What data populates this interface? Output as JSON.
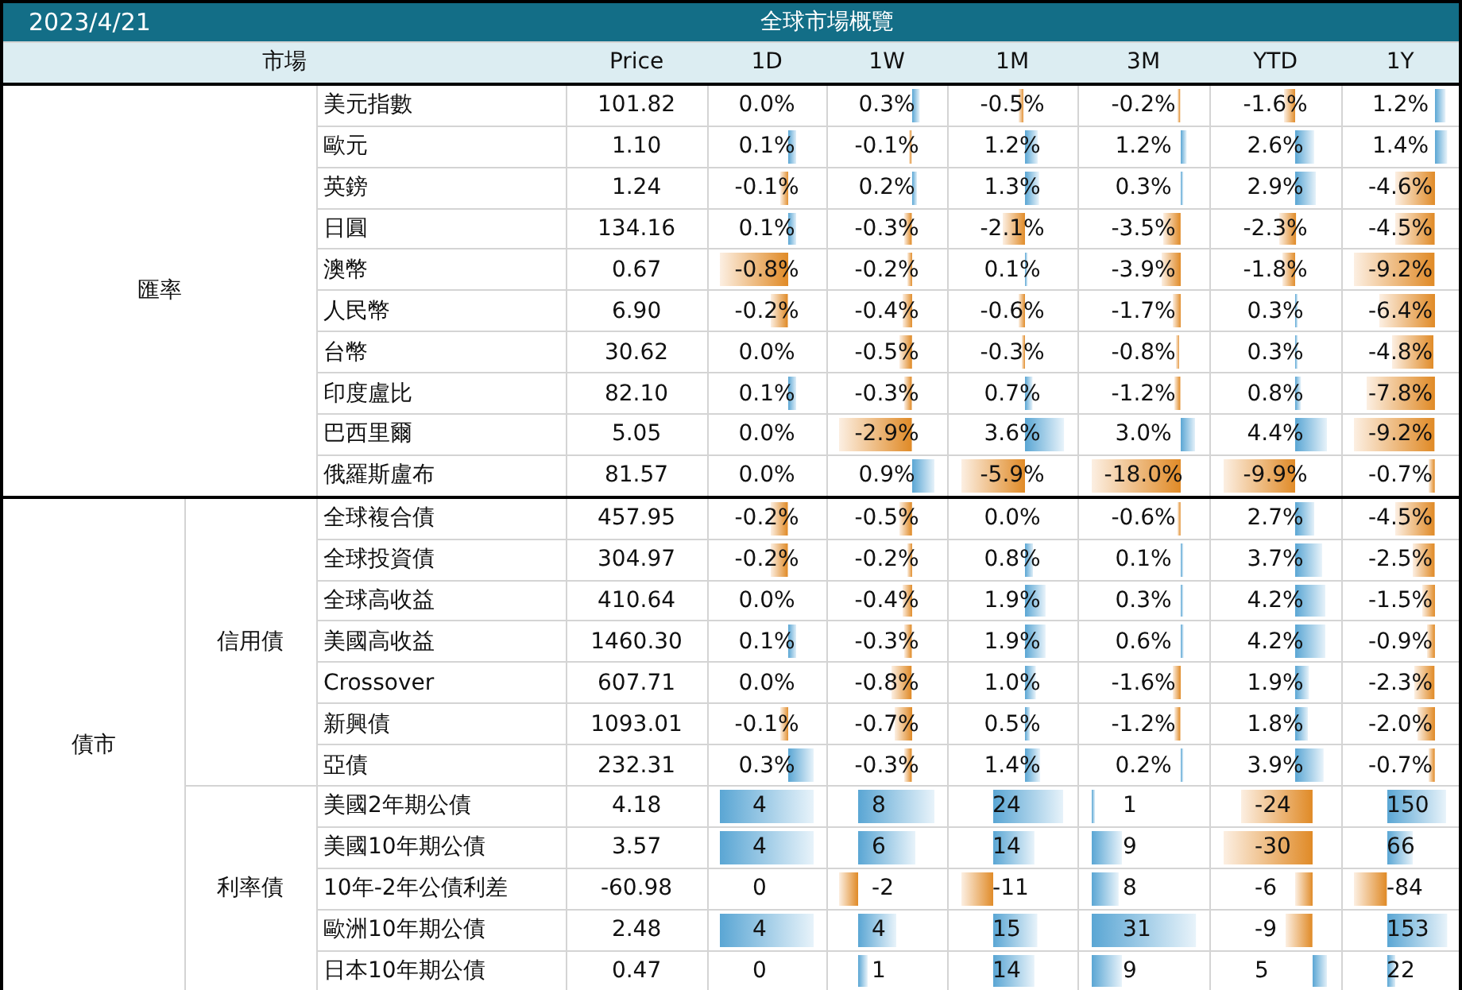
{
  "header": {
    "date": "2023/4/21",
    "title": "全球市場概覽"
  },
  "columns": {
    "market": "市場",
    "price": "Price",
    "periods": [
      "1D",
      "1W",
      "1M",
      "3M",
      "YTD",
      "1Y"
    ]
  },
  "groups": [
    {
      "name": "匯率",
      "subgroups": [
        {
          "kind": "percent",
          "rows": [
            {
              "name": "美元指數",
              "price": "101.82",
              "changes": [
                "0.0%",
                "0.3%",
                "-0.5%",
                "-0.2%",
                "-1.6%",
                "1.2%"
              ]
            },
            {
              "name": "歐元",
              "price": "1.10",
              "changes": [
                "0.1%",
                "-0.1%",
                "1.2%",
                "1.2%",
                "2.6%",
                "1.4%"
              ]
            },
            {
              "name": "英鎊",
              "price": "1.24",
              "changes": [
                "-0.1%",
                "0.2%",
                "1.3%",
                "0.3%",
                "2.9%",
                "-4.6%"
              ]
            },
            {
              "name": "日圓",
              "price": "134.16",
              "changes": [
                "0.1%",
                "-0.3%",
                "-2.1%",
                "-3.5%",
                "-2.3%",
                "-4.5%"
              ]
            },
            {
              "name": "澳幣",
              "price": "0.67",
              "changes": [
                "-0.8%",
                "-0.2%",
                "0.1%",
                "-3.9%",
                "-1.8%",
                "-9.2%"
              ]
            },
            {
              "name": "人民幣",
              "price": "6.90",
              "changes": [
                "-0.2%",
                "-0.4%",
                "-0.6%",
                "-1.7%",
                "0.3%",
                "-6.4%"
              ]
            },
            {
              "name": "台幣",
              "price": "30.62",
              "changes": [
                "0.0%",
                "-0.5%",
                "-0.3%",
                "-0.8%",
                "0.3%",
                "-4.8%"
              ]
            },
            {
              "name": "印度盧比",
              "price": "82.10",
              "changes": [
                "0.1%",
                "-0.3%",
                "0.7%",
                "-1.2%",
                "0.8%",
                "-7.8%"
              ]
            },
            {
              "name": "巴西里爾",
              "price": "5.05",
              "changes": [
                "0.0%",
                "-2.9%",
                "3.6%",
                "3.0%",
                "4.4%",
                "-9.2%"
              ]
            },
            {
              "name": "俄羅斯盧布",
              "price": "81.57",
              "changes": [
                "0.0%",
                "0.9%",
                "-5.9%",
                "-18.0%",
                "-9.9%",
                "-0.7%"
              ]
            }
          ]
        }
      ]
    },
    {
      "name": "債市",
      "subgroups": [
        {
          "name": "信用債",
          "kind": "percent",
          "rows": [
            {
              "name": "全球複合債",
              "price": "457.95",
              "changes": [
                "-0.2%",
                "-0.5%",
                "0.0%",
                "-0.6%",
                "2.7%",
                "-4.5%"
              ]
            },
            {
              "name": "全球投資債",
              "price": "304.97",
              "changes": [
                "-0.2%",
                "-0.2%",
                "0.8%",
                "0.1%",
                "3.7%",
                "-2.5%"
              ]
            },
            {
              "name": "全球高收益",
              "price": "410.64",
              "changes": [
                "0.0%",
                "-0.4%",
                "1.9%",
                "0.3%",
                "4.2%",
                "-1.5%"
              ]
            },
            {
              "name": "美國高收益",
              "price": "1460.30",
              "changes": [
                "0.1%",
                "-0.3%",
                "1.9%",
                "0.6%",
                "4.2%",
                "-0.9%"
              ]
            },
            {
              "name": "Crossover",
              "price": "607.71",
              "changes": [
                "0.0%",
                "-0.8%",
                "1.0%",
                "-1.6%",
                "1.9%",
                "-2.3%"
              ]
            },
            {
              "name": "新興債",
              "price": "1093.01",
              "changes": [
                "-0.1%",
                "-0.7%",
                "0.5%",
                "-1.2%",
                "1.8%",
                "-2.0%"
              ]
            },
            {
              "name": "亞債",
              "price": "232.31",
              "changes": [
                "0.3%",
                "-0.3%",
                "1.4%",
                "0.2%",
                "3.9%",
                "-0.7%"
              ]
            }
          ]
        },
        {
          "name": "利率債",
          "kind": "bp",
          "rows": [
            {
              "name": "美國2年期公債",
              "price": "4.18",
              "changes": [
                "4",
                "8",
                "24",
                "1",
                "-24",
                "150"
              ]
            },
            {
              "name": "美國10年期公債",
              "price": "3.57",
              "changes": [
                "4",
                "6",
                "14",
                "9",
                "-30",
                "66"
              ]
            },
            {
              "name": "10年-2年公債利差",
              "price": "-60.98",
              "changes": [
                "0",
                "-2",
                "-11",
                "8",
                "-6",
                "-84"
              ]
            },
            {
              "name": "歐洲10年期公債",
              "price": "2.48",
              "changes": [
                "4",
                "4",
                "15",
                "31",
                "-9",
                "153"
              ]
            },
            {
              "name": "日本10年期公債",
              "price": "0.47",
              "changes": [
                "0",
                "1",
                "14",
                "9",
                "5",
                "22"
              ]
            }
          ]
        }
      ]
    }
  ]
}
